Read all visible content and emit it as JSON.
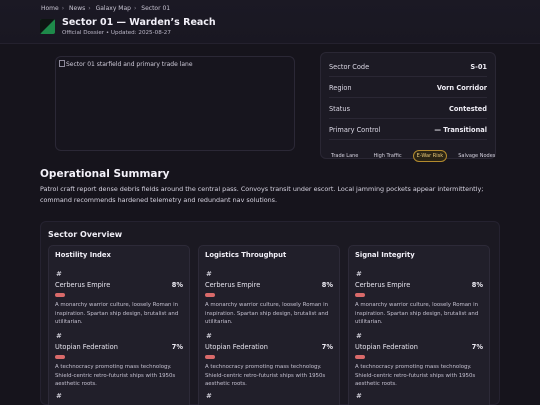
{
  "breadcrumb": [
    "Home",
    "News",
    "Galaxy Map",
    "Sector 01"
  ],
  "header": {
    "title": "Sector 01 — Warden’s Reach",
    "subtitle": "Official Dossier • Updated: 2025-08-27"
  },
  "hero_image": {
    "alt": "Sector 01 starfield and primary trade lane"
  },
  "info": {
    "rows": [
      {
        "label": "Sector Code",
        "value": "S-01"
      },
      {
        "label": "Region",
        "value": "Vorn Corridor"
      },
      {
        "label": "Status",
        "value": "Contested"
      },
      {
        "label": "Primary Control",
        "value": "— Transitional"
      }
    ],
    "tags": [
      "Trade Lane",
      "High Traffic",
      "E-War Risk",
      "Salvage Nodes"
    ]
  },
  "summary": {
    "title": "Operational Summary",
    "text": "Patrol craft report dense debris fields around the central pass. Convoys transit under escort. Local jamming pockets appear intermittently; command recommends hardened telemetry and redundant nav solutions."
  },
  "overview": {
    "title": "Sector Overview",
    "cards": [
      {
        "title": "Hostility Index",
        "factions": [
          {
            "hash": "#",
            "name": "Cerberus Empire",
            "pct": "8%",
            "value": 8,
            "desc": "A monarchy warrior culture, loosely Roman in inspiration. Spartan ship design, brutalist and utilitarian."
          },
          {
            "hash": "#",
            "name": "Utopian Federation",
            "pct": "7%",
            "value": 7,
            "desc": "A technocracy promoting mass technology. Shield-centric retro-futurist ships with 1950s aesthetic roots."
          }
        ],
        "trailing_hash": "#"
      },
      {
        "title": "Logistics Throughput",
        "factions": [
          {
            "hash": "#",
            "name": "Cerberus Empire",
            "pct": "8%",
            "value": 8,
            "desc": "A monarchy warrior culture, loosely Roman in inspiration. Spartan ship design, brutalist and utilitarian."
          },
          {
            "hash": "#",
            "name": "Utopian Federation",
            "pct": "7%",
            "value": 7,
            "desc": "A technocracy promoting mass technology. Shield-centric retro-futurist ships with 1950s aesthetic roots."
          }
        ],
        "trailing_hash": "#"
      },
      {
        "title": "Signal Integrity",
        "factions": [
          {
            "hash": "#",
            "name": "Cerberus Empire",
            "pct": "8%",
            "value": 8,
            "desc": "A monarchy warrior culture, loosely Roman in inspiration. Spartan ship design, brutalist and utilitarian."
          },
          {
            "hash": "#",
            "name": "Utopian Federation",
            "pct": "7%",
            "value": 7,
            "desc": "A technocracy promoting mass technology. Shield-centric retro-futurist ships with 1950s aesthetic roots."
          }
        ],
        "trailing_hash": "#"
      }
    ]
  },
  "colors": {
    "accent_bar": "#d96a6a",
    "warn_tag": "#b28a2e",
    "logo": "#1e8a4a"
  }
}
